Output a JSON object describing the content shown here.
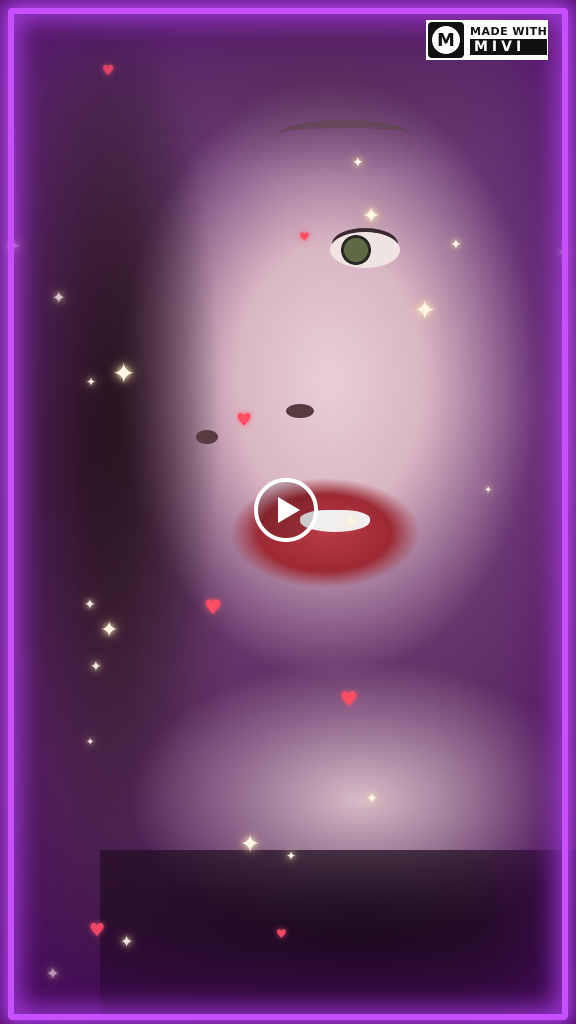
{
  "watermark": {
    "logo_letter": "M",
    "line1": "MADE WITH",
    "line2": "MIVI"
  },
  "player": {
    "play_icon": "play-icon",
    "state": "paused"
  },
  "colors": {
    "frame_neon": "#c650ff",
    "heart": "#ff4d63",
    "sparkle": "#fff7e6"
  }
}
